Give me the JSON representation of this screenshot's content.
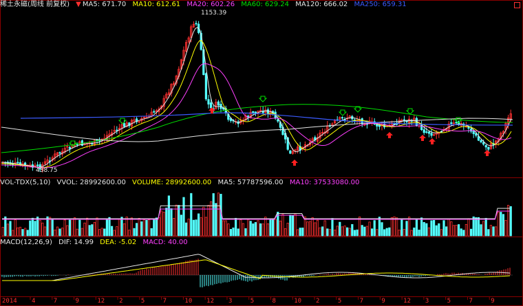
{
  "price_header": {
    "title": "稀土永磁(周线 前复权)",
    "ma5": "MA5: 671.70",
    "ma10": "MA10: 612.61",
    "ma20": "MA20: 602.26",
    "ma60": "MA60: 629.24",
    "ma120": "MA120: 666.02",
    "ma250": "MA250: 659.31",
    "high_label": "1153.39",
    "low_label": "438.75"
  },
  "volume_header": {
    "title": "VOL-TDX(5,10)",
    "vvol": "VVOL: 28992600.00",
    "volume": "VOLUME: 28992600.00",
    "ma5": "MA5: 57787596.00",
    "ma10": "MA10: 37533080.00"
  },
  "macd_header": {
    "title": "MACD(12,26,9)",
    "dif": "DIF: 14.99",
    "dea": "DEA: -5.02",
    "macd": "MACD: 40.00"
  },
  "x_axis": {
    "year": "2014",
    "ticks": [
      "4",
      "7",
      "9",
      "12",
      "2",
      "5",
      "7",
      "10",
      "12",
      "3",
      "5",
      "8",
      "10",
      "2",
      "5",
      "7",
      "9",
      "12",
      "3",
      "5",
      "7",
      "9"
    ]
  },
  "colors": {
    "up": "#ff3030",
    "down": "#54ffff",
    "ma5": "#e6e6e6",
    "ma10": "#ffff00",
    "ma20": "#ff40ff",
    "ma60": "#00e000",
    "ma120": "#e6e6e6",
    "ma250": "#3b5bff"
  },
  "icons": [
    "close-indicator-icon",
    "buy-signal-arrow-icon",
    "sell-signal-arrow-icon"
  ]
}
